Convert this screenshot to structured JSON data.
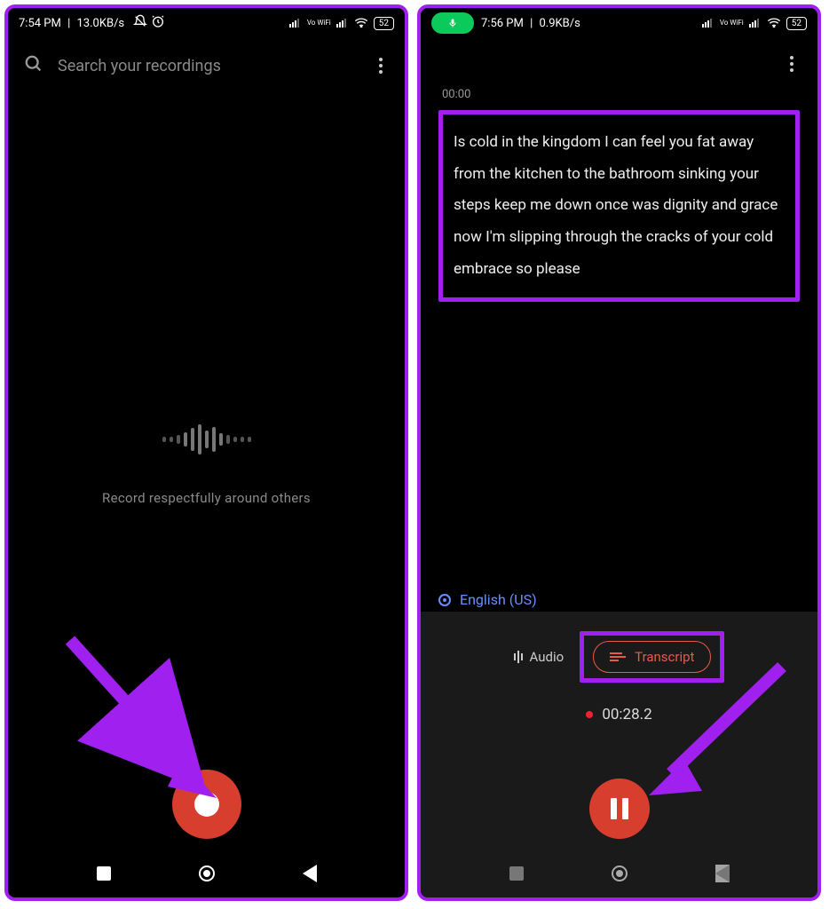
{
  "left": {
    "status": {
      "time": "7:54 PM",
      "net": "13.0KB/s",
      "vo_wifi": "Vo WiFi",
      "battery": "52"
    },
    "search": {
      "placeholder": "Search your recordings"
    },
    "hint": "Record respectfully around others"
  },
  "right": {
    "status": {
      "time": "7:56 PM",
      "net": "0.9KB/s",
      "vo_wifi": "Vo WiFi",
      "battery": "52"
    },
    "timestamp": "00:00",
    "transcript": "Is cold in the kingdom I can feel you fat away from the kitchen to the bathroom sinking your steps keep me down once was dignity and grace now I'm slipping through the cracks of your cold embrace so please",
    "language": "English (US)",
    "tabs": {
      "audio": "Audio",
      "transcript": "Transcript"
    },
    "timer": "00:28.2"
  }
}
